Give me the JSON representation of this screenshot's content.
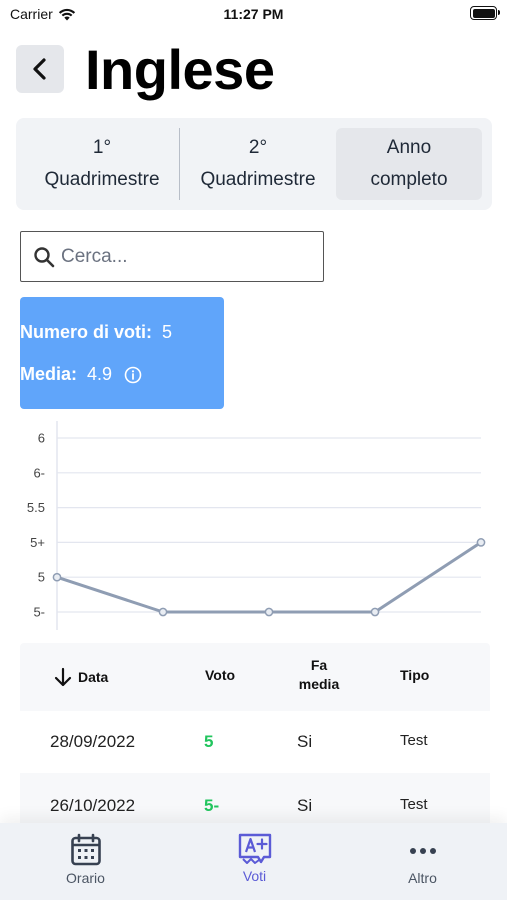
{
  "status_bar": {
    "carrier": "Carrier",
    "time": "11:27 PM"
  },
  "header": {
    "title": "Inglese"
  },
  "segments": [
    {
      "line1": "1°",
      "line2": "Quadrimestre"
    },
    {
      "line1": "2°",
      "line2": "Quadrimestre"
    },
    {
      "line1": "Anno",
      "line2": "completo",
      "selected": true
    }
  ],
  "search": {
    "placeholder": "Cerca...",
    "value": ""
  },
  "stats": {
    "count_label": "Numero di voti:",
    "count_value": "5",
    "avg_label": "Media:",
    "avg_value": "4.9"
  },
  "chart_data": {
    "type": "line",
    "y_tick_labels": [
      "6",
      "6-",
      "5.5",
      "5+",
      "5",
      "5-"
    ],
    "y_tick_values": [
      6,
      5.75,
      5.5,
      5.25,
      5,
      4.75
    ],
    "ylim": [
      4.75,
      6
    ],
    "values": [
      5,
      4.75,
      4.75,
      4.75,
      5.25
    ],
    "grid": true,
    "colors": {
      "line": "#8f9db3",
      "grid": "#e3e6ef"
    }
  },
  "table": {
    "headers": {
      "date": "Data",
      "grade": "Voto",
      "average_line1": "Fa",
      "average_line2": "media",
      "type": "Tipo"
    },
    "rows": [
      {
        "date": "28/09/2022",
        "grade": "5",
        "in_average": "Si",
        "type": "Test"
      },
      {
        "date": "26/10/2022",
        "grade": "5-",
        "in_average": "Si",
        "type": "Test"
      }
    ]
  },
  "tabs": [
    {
      "label": "Orario",
      "icon": "calendar-icon"
    },
    {
      "label": "Voti",
      "icon": "grades-icon",
      "active": true
    },
    {
      "label": "Altro",
      "icon": "more-icon"
    }
  ],
  "colors": {
    "accent": "#5b5bd6",
    "card": "#60a5fa",
    "grade_green": "#22c55e"
  }
}
